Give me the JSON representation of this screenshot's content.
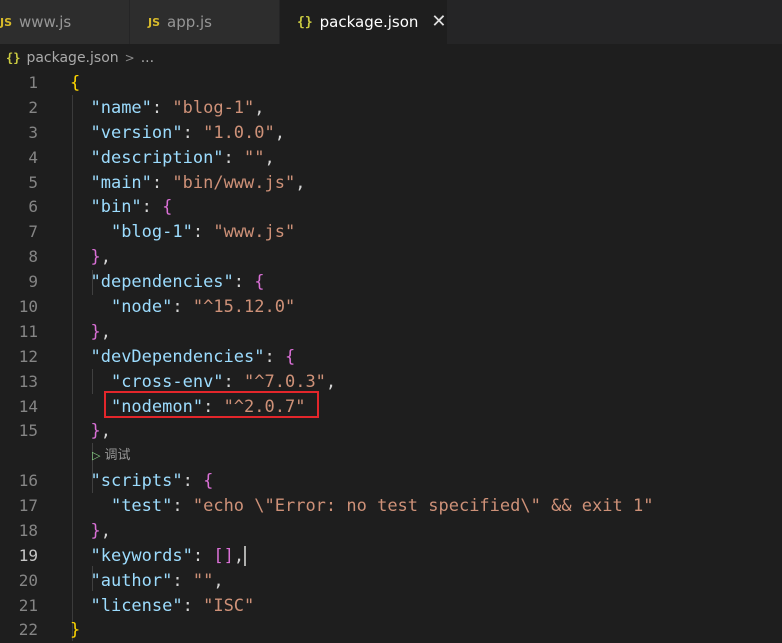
{
  "tabs": [
    {
      "icon": "JS",
      "label": "www.js"
    },
    {
      "icon": "JS",
      "label": "app.js"
    },
    {
      "icon": "{}",
      "label": "package.json",
      "close": "✕"
    }
  ],
  "breadcrumb": {
    "icon": "{}",
    "file": "package.json",
    "more": "..."
  },
  "codelens": {
    "label": "调试"
  },
  "editor": {
    "current_line": "19",
    "lines": [
      {
        "n": "1"
      },
      {
        "n": "2"
      },
      {
        "n": "3"
      },
      {
        "n": "4"
      },
      {
        "n": "5"
      },
      {
        "n": "6"
      },
      {
        "n": "7"
      },
      {
        "n": "8"
      },
      {
        "n": "9"
      },
      {
        "n": "10"
      },
      {
        "n": "11"
      },
      {
        "n": "12"
      },
      {
        "n": "13"
      },
      {
        "n": "14"
      },
      {
        "n": "15"
      },
      {
        "n": "16"
      },
      {
        "n": "17"
      },
      {
        "n": "18"
      },
      {
        "n": "19"
      },
      {
        "n": "20"
      },
      {
        "n": "21"
      },
      {
        "n": "22"
      }
    ],
    "code": {
      "l1": "{",
      "name_key": "\"name\"",
      "name_val": "\"blog-1\"",
      "version_key": "\"version\"",
      "version_val": "\"1.0.0\"",
      "description_key": "\"description\"",
      "description_val": "\"\"",
      "main_key": "\"main\"",
      "main_val": "\"bin/www.js\"",
      "bin_key": "\"bin\"",
      "bin_blog_key": "\"blog-1\"",
      "bin_blog_val": "\"www.js\"",
      "deps_key": "\"dependencies\"",
      "node_key": "\"node\"",
      "node_val": "\"^15.12.0\"",
      "devdeps_key": "\"devDependencies\"",
      "crossenv_key": "\"cross-env\"",
      "crossenv_val": "\"^7.0.3\"",
      "nodemon_key": "\"nodemon\"",
      "nodemon_val": "\"^2.0.7\"",
      "scripts_key": "\"scripts\"",
      "test_key": "\"test\"",
      "test_val": "\"echo \\\"Error: no test specified\\\" && exit 1\"",
      "keywords_key": "\"keywords\"",
      "keywords_val": "[]",
      "author_key": "\"author\"",
      "author_val": "\"\"",
      "license_key": "\"license\"",
      "license_val": "\"ISC\"",
      "l22": "}"
    }
  },
  "colors": {
    "background": "#1e1e1e",
    "key": "#9cdcfe",
    "string": "#ce9178",
    "brace_level1": "#ffd700",
    "brace_level2": "#da70d6",
    "highlight_box": "#e3262b"
  }
}
